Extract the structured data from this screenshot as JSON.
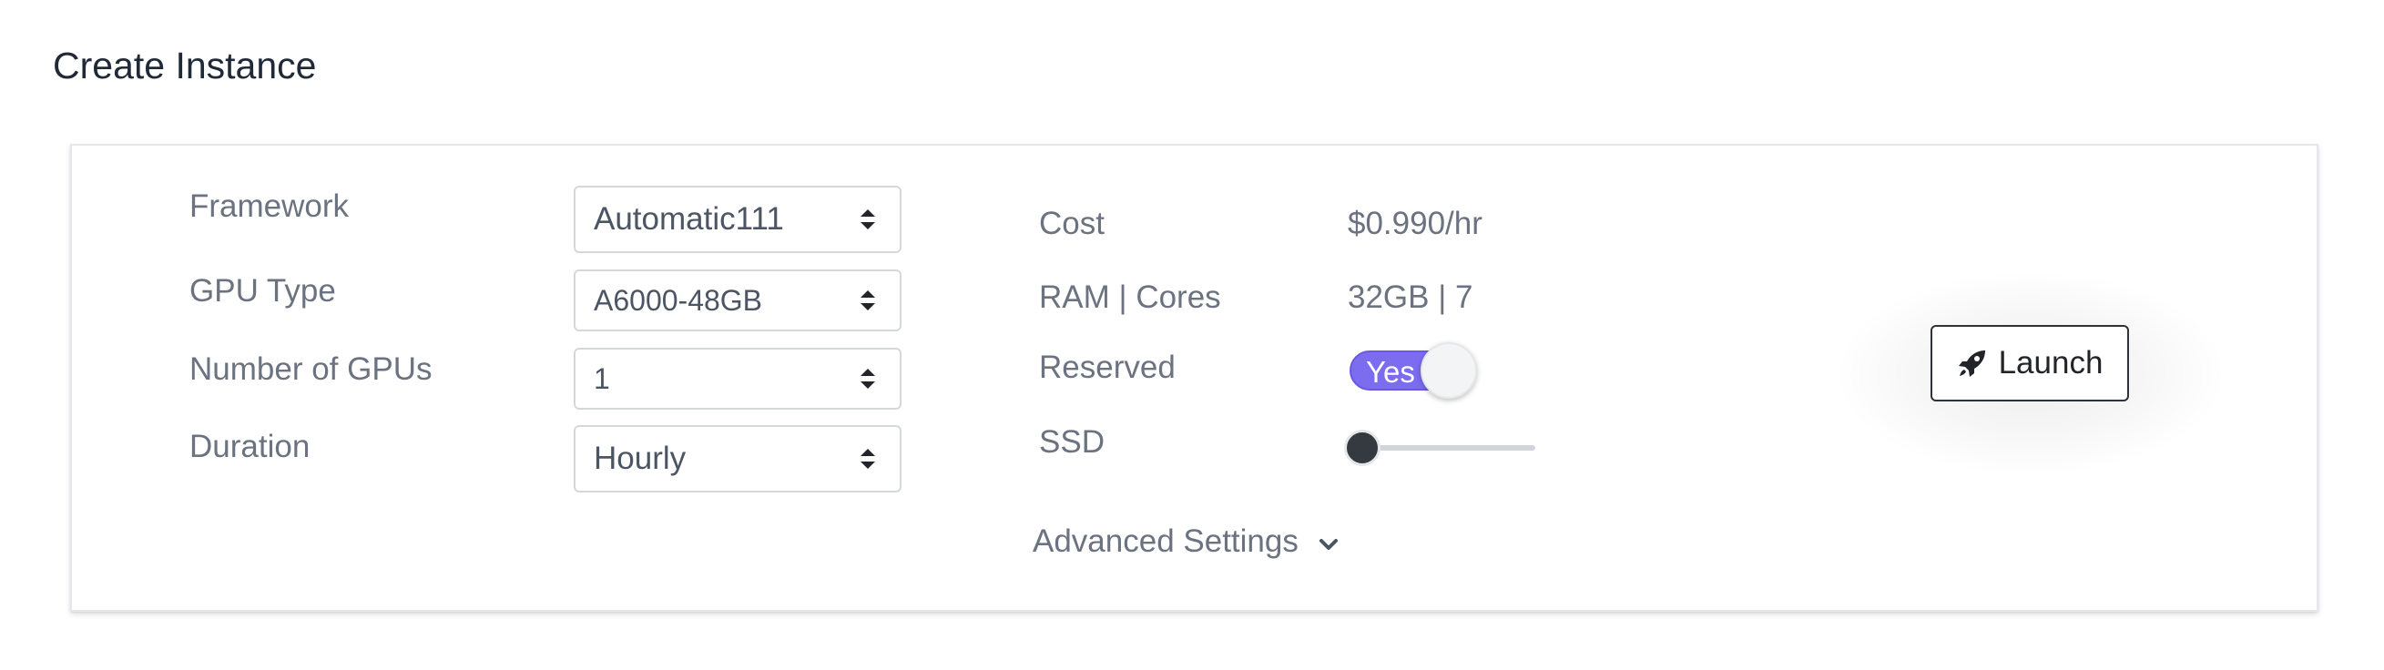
{
  "page": {
    "title": "Create Instance"
  },
  "form": {
    "framework": {
      "label": "Framework",
      "value": "Automatic111"
    },
    "gpu_type": {
      "label": "GPU Type",
      "value": "A6000-48GB"
    },
    "num_gpus": {
      "label": "Number of GPUs",
      "value": "1"
    },
    "duration": {
      "label": "Duration",
      "value": "Hourly"
    }
  },
  "summary": {
    "cost": {
      "label": "Cost",
      "value": "$0.990/hr"
    },
    "ram_cores": {
      "label": "RAM | Cores",
      "value": "32GB | 7"
    },
    "reserved": {
      "label": "Reserved",
      "toggle_text": "Yes",
      "on": true
    },
    "ssd": {
      "label": "SSD",
      "slider_fraction": 0.0
    }
  },
  "advanced": {
    "label": "Advanced Settings"
  },
  "launch": {
    "label": "Launch",
    "icon": "rocket-icon"
  },
  "colors": {
    "toggle_on": "#7c6cf0",
    "slider_thumb": "#343a40",
    "text_muted": "#6b7280",
    "title": "#1f2937"
  }
}
